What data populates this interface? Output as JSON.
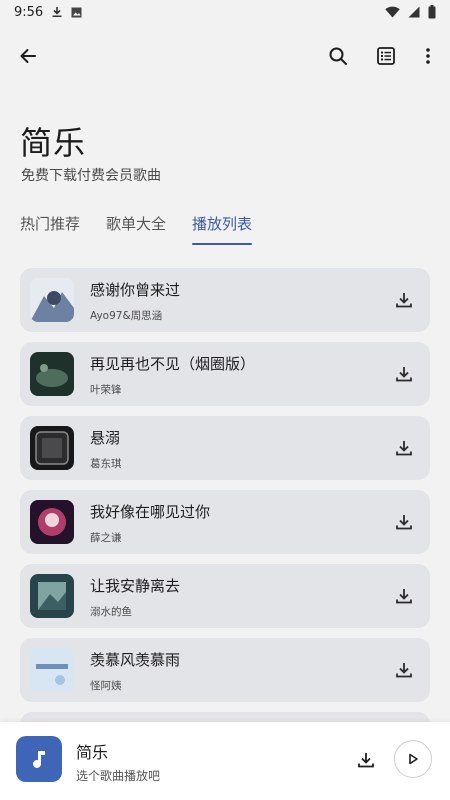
{
  "status_bar": {
    "time": "9:56",
    "icons": [
      "download-icon",
      "photo-icon",
      "wifi-icon",
      "signal-icon",
      "battery-icon"
    ]
  },
  "top_bar": {
    "icons": [
      "back-arrow-icon",
      "search-icon",
      "list-icon",
      "more-vert-icon"
    ]
  },
  "header": {
    "title": "简乐",
    "subtitle": "免费下载付费会员歌曲"
  },
  "tabs": [
    {
      "label": "热门推荐",
      "active": false
    },
    {
      "label": "歌单大全",
      "active": false
    },
    {
      "label": "播放列表",
      "active": true
    }
  ],
  "songs": [
    {
      "title": "感谢你曾来过",
      "artist": "Ayo97&周思涵",
      "cover_colors": [
        "#dfe6ee",
        "#5a6f8c"
      ]
    },
    {
      "title": "再见再也不见（烟圈版）",
      "artist": "叶荣锋",
      "cover_colors": [
        "#243630",
        "#5d7b6a"
      ]
    },
    {
      "title": "悬溺",
      "artist": "葛东琪",
      "cover_colors": [
        "#1b1b1d",
        "#777777"
      ]
    },
    {
      "title": "我好像在哪见过你",
      "artist": "薛之谦",
      "cover_colors": [
        "#2a1632",
        "#c24a78"
      ]
    },
    {
      "title": "让我安静离去",
      "artist": "溺水的鱼",
      "cover_colors": [
        "#2c4a4f",
        "#8cb0ad"
      ]
    },
    {
      "title": "羡慕风羡慕雨",
      "artist": "怪阿姨",
      "cover_colors": [
        "#dce8f4",
        "#9cbde0"
      ]
    }
  ],
  "player": {
    "title": "简乐",
    "subtitle": "选个歌曲播放吧",
    "accent_color": "#3f65b6"
  },
  "colors": {
    "background": "#f2f2f2",
    "card": "#e3e4e8",
    "tab_active": "#3b5ba8"
  }
}
